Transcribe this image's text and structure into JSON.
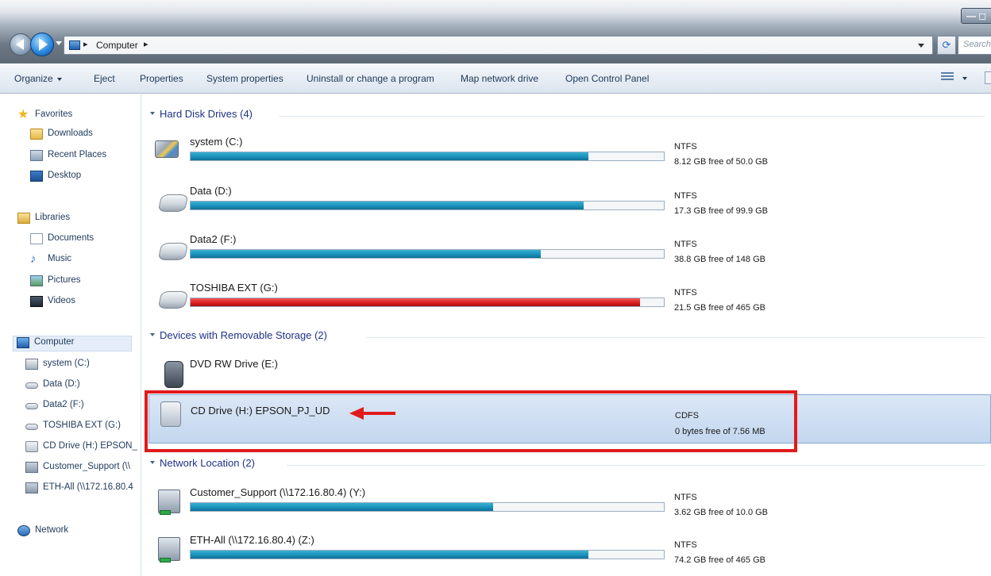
{
  "addressbar": {
    "path": [
      "Computer"
    ],
    "search_placeholder": "Search"
  },
  "toolbar": {
    "items": [
      "Organize",
      "Eject",
      "Properties",
      "System properties",
      "Uninstall or change a program",
      "Map network drive",
      "Open Control Panel"
    ]
  },
  "sidebar": {
    "favorites_label": "Favorites",
    "favorites": [
      "Downloads",
      "Recent Places",
      "Desktop"
    ],
    "libraries_label": "Libraries",
    "libraries": [
      "Documents",
      "Music",
      "Pictures",
      "Videos"
    ],
    "computer_label": "Computer",
    "computer_items": [
      "system (C:)",
      "Data (D:)",
      "Data2 (F:)",
      "TOSHIBA EXT (G:)",
      "CD Drive (H:) EPSON_",
      "Customer_Support (\\\\",
      "ETH-All (\\\\172.16.80.4"
    ],
    "network_label": "Network"
  },
  "groups": {
    "hdd": "Hard Disk Drives (4)",
    "removable": "Devices with Removable Storage (2)",
    "network": "Network Location (2)"
  },
  "drives": [
    {
      "name": "system (C:)",
      "fs": "NTFS",
      "free": "8.12 GB free of 50.0 GB",
      "used_fraction": 0.84
    },
    {
      "name": "Data (D:)",
      "fs": "NTFS",
      "free": "17.3 GB free of 99.9 GB",
      "used_fraction": 0.83
    },
    {
      "name": "Data2 (F:)",
      "fs": "NTFS",
      "free": "38.8 GB free of 148 GB",
      "used_fraction": 0.74
    },
    {
      "name": "TOSHIBA EXT (G:)",
      "fs": "NTFS",
      "free": "21.5 GB free of 465 GB",
      "used_fraction": 0.95,
      "warning": true
    }
  ],
  "removable": [
    {
      "name": "DVD RW Drive (E:)"
    },
    {
      "name": "CD Drive (H:) EPSON_PJ_UD",
      "fs": "CDFS",
      "free": "0 bytes free of 7.56 MB"
    }
  ],
  "network_drives": [
    {
      "name": "Customer_Support (\\\\172.16.80.4) (Y:)",
      "fs": "NTFS",
      "free": "3.62 GB free of 10.0 GB",
      "used_fraction": 0.64
    },
    {
      "name": "ETH-All (\\\\172.16.80.4) (Z:)",
      "fs": "NTFS",
      "free": "74.2 GB free of 465 GB",
      "used_fraction": 0.84
    }
  ],
  "colors": {
    "bar_normal": "#1a91bb",
    "bar_warning": "#dc1f1f",
    "annotation": "#e01b1b"
  }
}
